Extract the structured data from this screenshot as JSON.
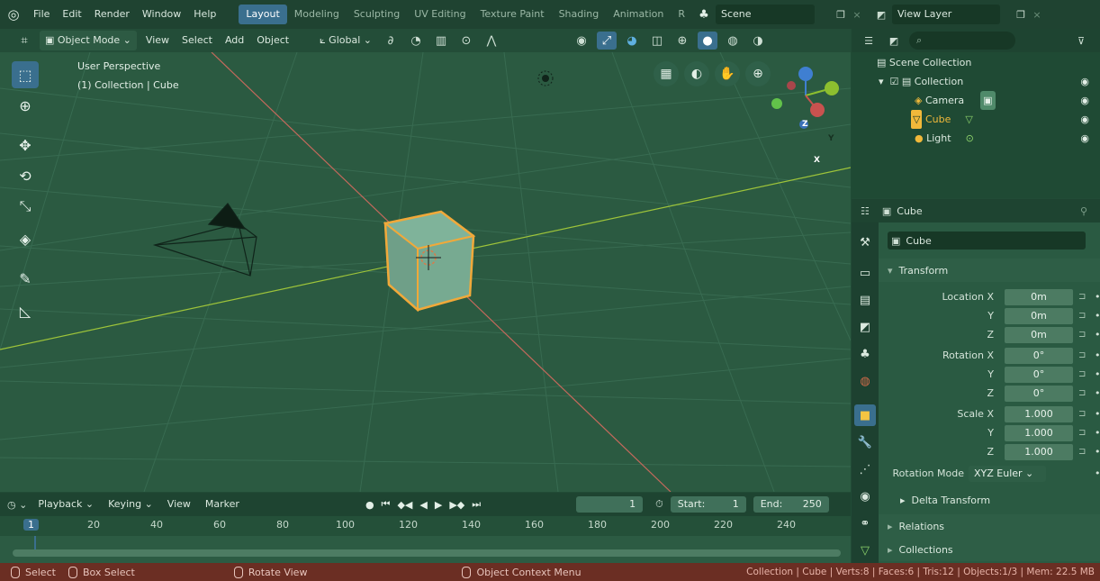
{
  "topbar": {
    "menus": [
      "File",
      "Edit",
      "Render",
      "Window",
      "Help"
    ],
    "workspaces": [
      "Layout",
      "Modeling",
      "Sculpting",
      "UV Editing",
      "Texture Paint",
      "Shading",
      "Animation",
      "R"
    ],
    "active_workspace": "Layout",
    "scene": "Scene",
    "view_layer": "View Layer"
  },
  "viewport_header": {
    "mode": "Object Mode",
    "menus": [
      "View",
      "Select",
      "Add",
      "Object"
    ],
    "orientation": "Global"
  },
  "viewport": {
    "view_name": "User Perspective",
    "context": "(1) Collection | Cube",
    "gizmo": {
      "z": "Z",
      "y": "Y",
      "x": "X"
    }
  },
  "outliner": {
    "search_placeholder": "",
    "root": "Scene Collection",
    "collection": "Collection",
    "items": [
      "Camera",
      "Cube",
      "Light"
    ]
  },
  "properties": {
    "header_object": "Cube",
    "object_name": "Cube",
    "transform_label": "Transform",
    "location": {
      "label": "Location X",
      "x": "0m",
      "y": "0m",
      "z": "0m"
    },
    "rotation": {
      "label": "Rotation X",
      "x": "0°",
      "y": "0°",
      "z": "0°"
    },
    "scale": {
      "label": "Scale X",
      "x": "1.000",
      "y": "1.000",
      "z": "1.000"
    },
    "axis_y": "Y",
    "axis_z": "Z",
    "rotation_mode_label": "Rotation Mode",
    "rotation_mode": "XYZ Euler",
    "delta_transform": "Delta Transform",
    "relations": "Relations",
    "collections": "Collections"
  },
  "timeline": {
    "menus": [
      "Playback",
      "Keying",
      "View",
      "Marker"
    ],
    "current_frame": "1",
    "start_label": "Start:",
    "start": "1",
    "end_label": "End:",
    "end": "250",
    "ticks": [
      "1",
      "20",
      "40",
      "60",
      "80",
      "100",
      "120",
      "140",
      "160",
      "180",
      "200",
      "220",
      "240"
    ]
  },
  "statusbar": {
    "select": "Select",
    "box_select": "Box Select",
    "rotate_view": "Rotate View",
    "context_menu": "Object Context Menu",
    "stats": "Collection | Cube | Verts:8 | Faces:6 | Tris:12 | Objects:1/3 | Mem: 22.5 MB"
  },
  "colors": {
    "accent": "#3a6f8e",
    "selected": "#f1b93a",
    "x_axis": "#c8524f",
    "y_axis": "#8dbf2f",
    "z_axis": "#3f7fd1"
  }
}
